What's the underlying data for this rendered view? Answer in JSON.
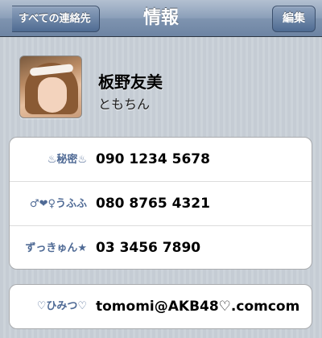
{
  "navbar": {
    "back_label": "すべての連絡先",
    "title": "情報",
    "edit_label": "編集"
  },
  "contact": {
    "name": "板野友美",
    "nickname": "ともちん"
  },
  "phones": [
    {
      "label": "♨秘密♨",
      "number": "090 1234 5678"
    },
    {
      "label": "♂❤♀うふふ",
      "number": "080 8765 4321"
    },
    {
      "label": "ずっきゅん★",
      "number": "03 3456 7890"
    }
  ],
  "email": {
    "label": "♡ひみつ♡",
    "address": "tomomi@AKB48♡.comcom"
  }
}
